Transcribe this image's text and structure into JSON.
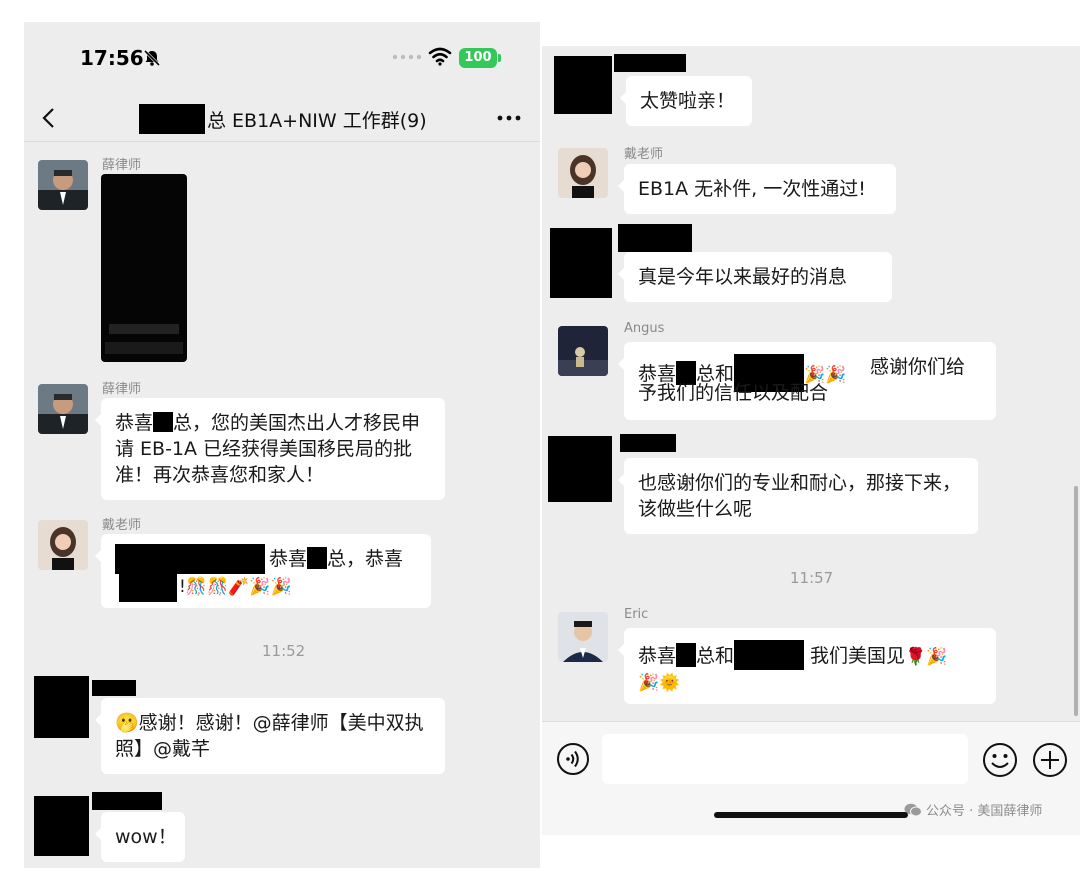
{
  "left": {
    "status_bar": {
      "time": "17:56",
      "battery": "100"
    },
    "nav": {
      "title": "总 EB1A+NIW 工作群(9)"
    },
    "messages": {
      "m1": {
        "sender": "薛律师"
      },
      "m2": {
        "sender": "薛律师",
        "text_a": "恭喜",
        "text_b": "总，您的美国杰出人才移民申请 EB-1A 已经获得美国移民局的批准！再次恭喜您和家人！"
      },
      "m3": {
        "sender": "戴老师",
        "text_a": "恭喜",
        "text_b": "总，恭喜",
        "emoji": "!🎊🎊🧨🎉🎉"
      },
      "time": "11:52",
      "m4": {
        "emoji": "🫢",
        "text": "感谢！感谢！@薛律师【美中双执照】@戴芊"
      },
      "m5": {
        "text": "wow！"
      }
    }
  },
  "right": {
    "messages": {
      "r1": {
        "text": "太赞啦亲！"
      },
      "r2": {
        "sender": "戴老师",
        "text": "EB1A 无补件, 一次性通过!"
      },
      "r3": {
        "text": "真是今年以来最好的消息"
      },
      "r4": {
        "sender": "Angus",
        "text_a": "恭喜",
        "text_b": "总和",
        "emoji": "🎉🎉",
        "text_c": "感谢你们给予我们的信任以及配合"
      },
      "r5": {
        "text": "也感谢你们的专业和耐心，那接下来，该做些什么呢"
      },
      "time": "11:57",
      "r6": {
        "sender": "Eric",
        "text_a": "恭喜",
        "text_b": "总和",
        "text_c": "我们美国见",
        "emoji_a": "🌹🎉",
        "emoji_b": "🎉🌞"
      }
    },
    "watermark": "公众号 · 美国薛律师"
  },
  "colors": {
    "chat_bg": "#ededed",
    "bubble": "#ffffff",
    "battery": "#34c759"
  },
  "icons": [
    "bell-slash-icon",
    "wifi-icon",
    "back-chevron-icon",
    "more-dots-icon",
    "voice-icon",
    "emoji-smile-icon",
    "plus-circle-icon",
    "wechat-icon"
  ]
}
